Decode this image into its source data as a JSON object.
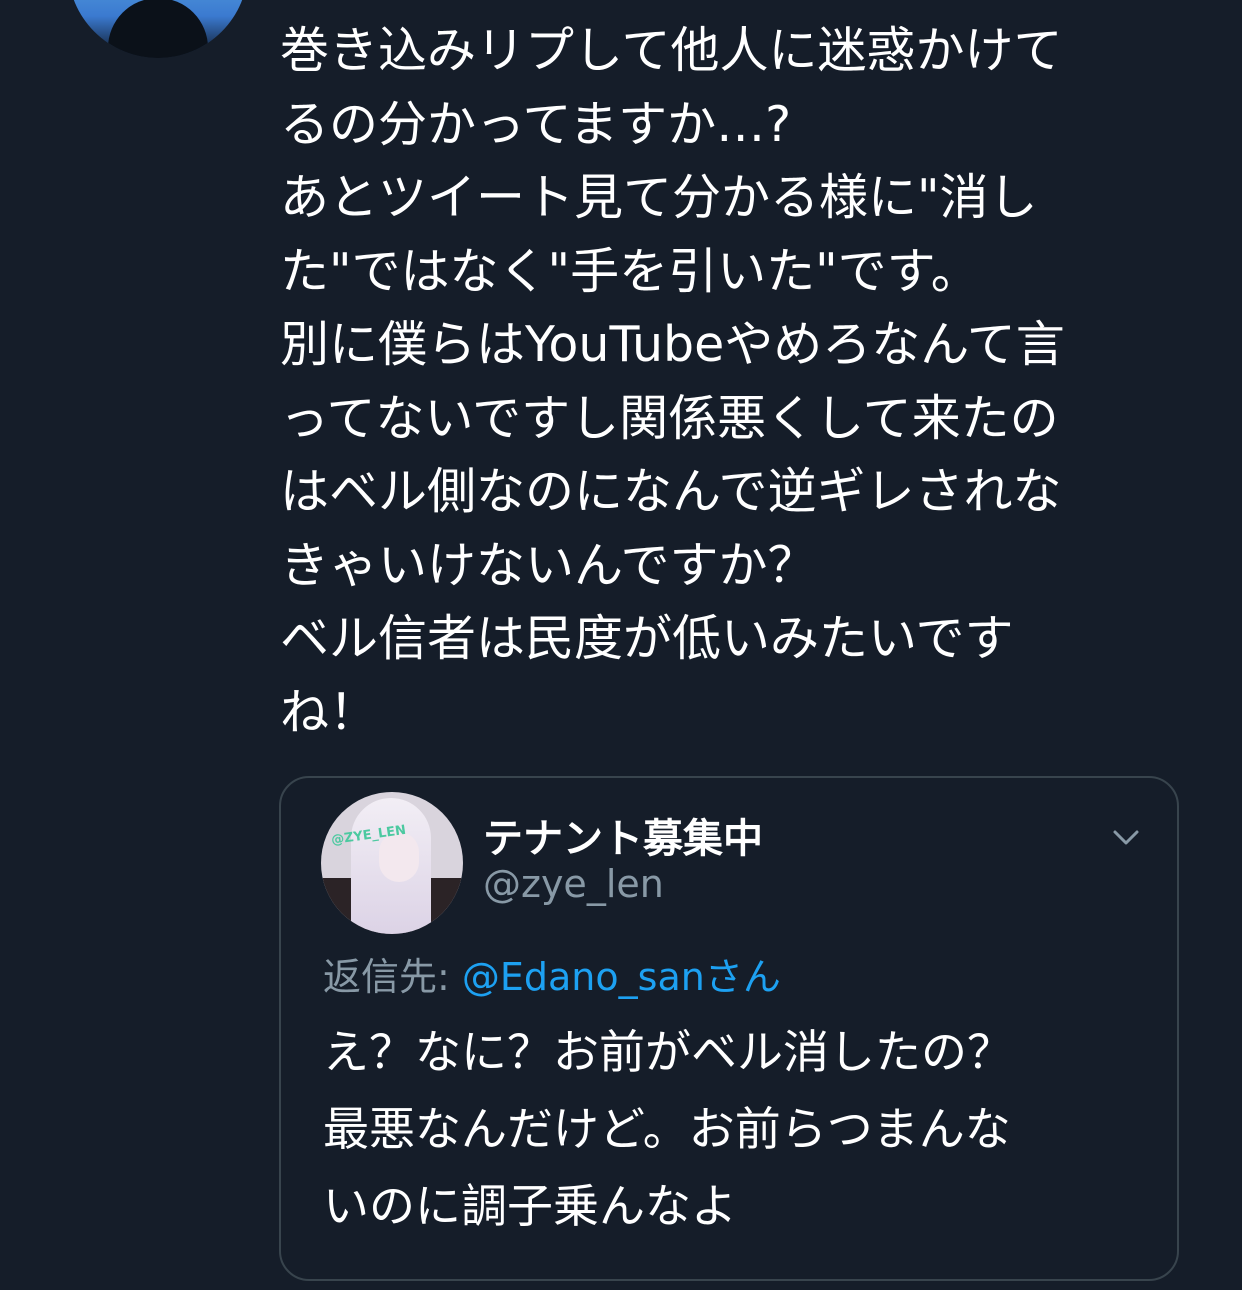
{
  "tweet": {
    "author_avatar_icon": "user-avatar",
    "text": "巻き込みリプして他人に迷惑かけて\nるの分かってますか…?\nあとツイート見て分かる様に\"消し\nた\"ではなく\"手を引いた\"です。\n別に僕らはYouTubeやめろなんて言\nってないですし関係悪くして来たの\nはベル側なのになんで逆ギレされな\nきゃいけないんですか？\nベル信者は民度が低いみたいです\nね！"
  },
  "quoted_tweet": {
    "avatar_icon": "anime-avatar",
    "avatar_tag": "@ZYE_LEN",
    "display_name": "テナント募集中",
    "handle": "@zye_len",
    "reply_prefix": "返信先: ",
    "reply_mention": "@Edano_san",
    "reply_suffix": "さん",
    "text": "え？なに？お前がベル消したの？\n最悪なんだけど。お前らつまんな\nいのに調子乗んなよ",
    "menu_icon": "chevron-down-icon"
  },
  "colors": {
    "background": "#151d29",
    "text": "#ffffff",
    "secondary_text": "#8899a6",
    "link": "#1da1f2",
    "border": "#38444d"
  }
}
